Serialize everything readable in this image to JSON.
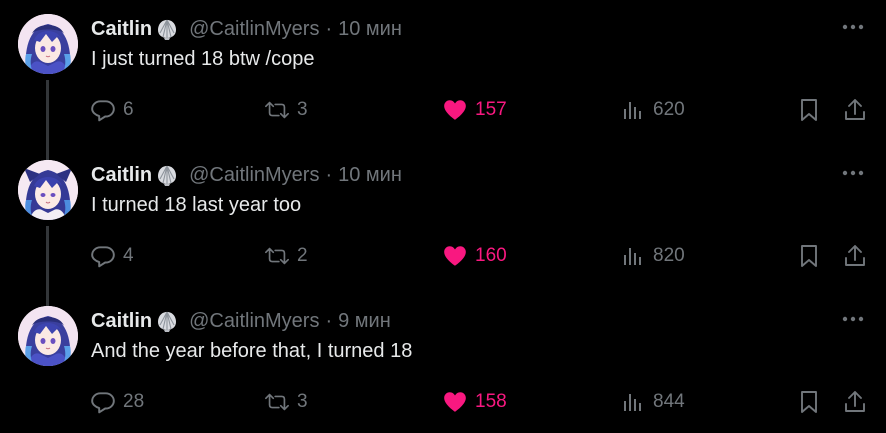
{
  "tweets": [
    {
      "name": "Caitlin",
      "handle": "@CaitlinMyers",
      "separator": "·",
      "time": "10 мин",
      "text": "I just turned 18 btw /cope",
      "replies": "6",
      "retweets": "3",
      "likes": "157",
      "views": "620"
    },
    {
      "name": "Caitlin",
      "handle": "@CaitlinMyers",
      "separator": "·",
      "time": "10 мин",
      "text": "I turned 18 last year too",
      "replies": "4",
      "retweets": "2",
      "likes": "160",
      "views": "820"
    },
    {
      "name": "Caitlin",
      "handle": "@CaitlinMyers",
      "separator": "·",
      "time": "9 мин",
      "text": "And the year before that, I turned 18",
      "replies": "28",
      "retweets": "3",
      "likes": "158",
      "views": "844"
    }
  ],
  "icons": {
    "badge": "shell-icon",
    "reply": "reply-icon",
    "retweet": "retweet-icon",
    "like": "heart-icon",
    "views": "views-icon",
    "bookmark": "bookmark-icon",
    "share": "share-icon",
    "more": "more-icon"
  },
  "colors": {
    "background": "#000000",
    "text": "#e7e9ea",
    "muted": "#71767b",
    "like_active": "#f91880",
    "thread_line": "#333639"
  }
}
